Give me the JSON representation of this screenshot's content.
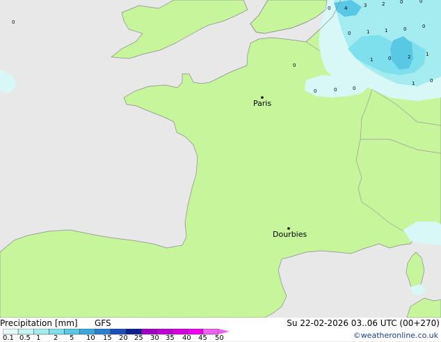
{
  "map": {
    "cities": [
      {
        "name": "Paris"
      },
      {
        "name": "Dourbies"
      }
    ],
    "precip_values": [
      "4",
      "3",
      "2",
      "0",
      "0",
      "0",
      "0",
      "1",
      "1",
      "0",
      "0",
      "2",
      "1",
      "0",
      "1",
      "1",
      "0",
      "0",
      "0",
      "0",
      "0",
      "0"
    ]
  },
  "legend": {
    "title": "Precipitation [mm]",
    "model": "GFS",
    "datetime": "Su 22-02-2026 03..06 UTC (00+270)",
    "credit": "©weatheronline.co.uk",
    "scale_labels": [
      "0.1",
      "0.5",
      "1",
      "2",
      "5",
      "10",
      "15",
      "20",
      "25",
      "30",
      "35",
      "40",
      "45",
      "50"
    ],
    "scale_colors": [
      "#e6fcfc",
      "#c6f4f4",
      "#a4ecf0",
      "#7ee0ec",
      "#58c8e4",
      "#3aa8dc",
      "#2a80d0",
      "#1a50b8",
      "#0a2090",
      "#a000c8",
      "#c000d8",
      "#d800e0",
      "#f000f0",
      "#f060f0"
    ]
  }
}
